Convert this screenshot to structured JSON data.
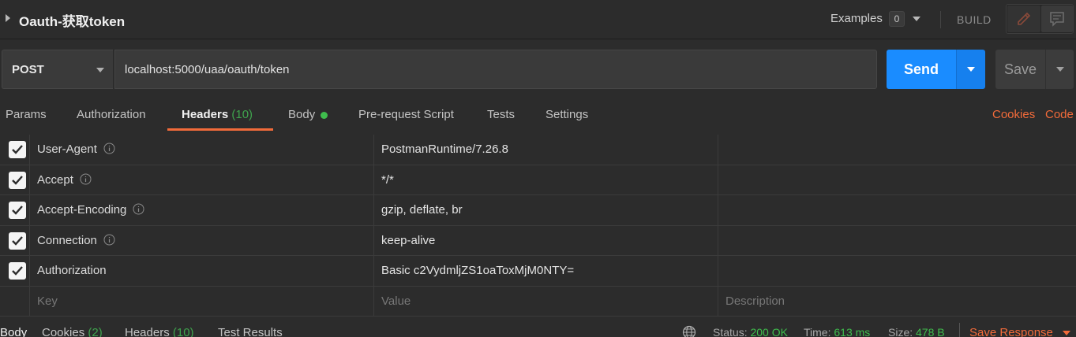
{
  "request": {
    "title": "Oauth-获取token",
    "examples_label": "Examples",
    "examples_count": "0",
    "build_label": "BUILD",
    "method": "POST",
    "url": "localhost:5000/uaa/oauth/token",
    "send_label": "Send",
    "save_label": "Save"
  },
  "tabs": [
    {
      "label": "Params"
    },
    {
      "label": "Authorization"
    },
    {
      "label": "Headers",
      "count": "(10)",
      "active": true
    },
    {
      "label": "Body",
      "indicator": "green-dot"
    },
    {
      "label": "Pre-request Script"
    },
    {
      "label": "Tests"
    },
    {
      "label": "Settings"
    }
  ],
  "links": {
    "cookies": "Cookies",
    "code": "Code"
  },
  "headers_table": {
    "rows": [
      {
        "key": "User-Agent",
        "value": "PostmanRuntime/7.26.8",
        "checked": true,
        "info_icon": true
      },
      {
        "key": "Accept",
        "value": "*/*",
        "checked": true,
        "info_icon": true
      },
      {
        "key": "Accept-Encoding",
        "value": "gzip, deflate, br",
        "checked": true,
        "info_icon": true
      },
      {
        "key": "Connection",
        "value": "keep-alive",
        "checked": true,
        "info_icon": true
      },
      {
        "key": "Authorization",
        "value": "Basic c2VydmljZS1oaToxMjM0NTY=",
        "checked": true,
        "info_icon": false
      }
    ],
    "placeholders": {
      "key": "Key",
      "value": "Value",
      "description": "Description"
    }
  },
  "response": {
    "tabs": [
      {
        "label": "Body",
        "active": true
      },
      {
        "label": "Cookies",
        "count": "(2)"
      },
      {
        "label": "Headers",
        "count": "(10)"
      },
      {
        "label": "Test Results"
      }
    ],
    "status_label": "Status:",
    "status_value": "200 OK",
    "time_label": "Time:",
    "time_value": "613 ms",
    "size_label": "Size:",
    "size_value": "478 B",
    "save_response_label": "Save Response"
  },
  "colors": {
    "accent": "#f26b3a",
    "send": "#1a8cff",
    "success": "#3fa34d",
    "background": "#2c2c2c"
  }
}
